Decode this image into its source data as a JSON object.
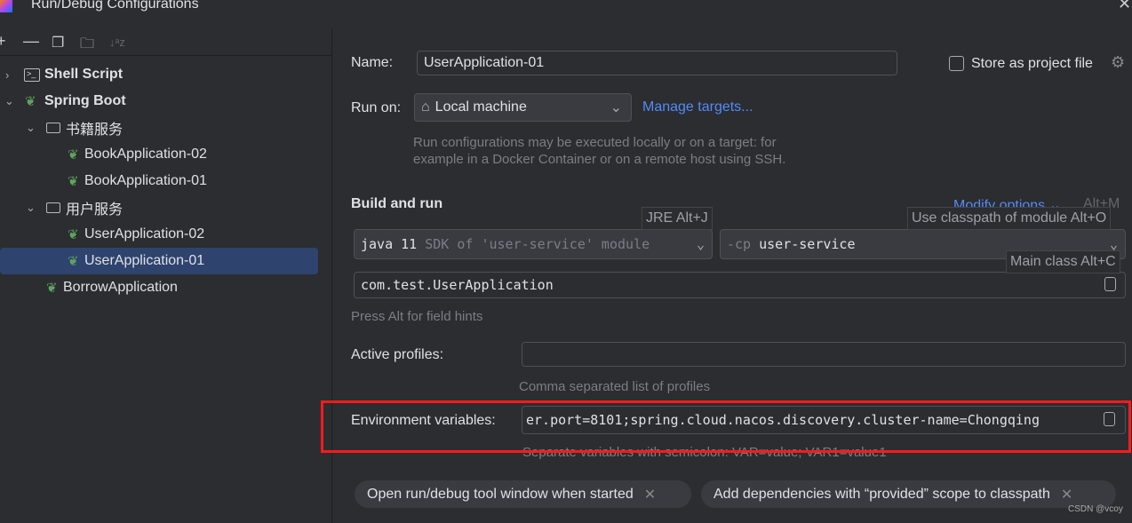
{
  "window": {
    "title": "Run/Debug Configurations"
  },
  "toolbar": {
    "icons": [
      "add-icon",
      "remove-icon",
      "copy-icon",
      "new-folder-icon",
      "sort-icon"
    ]
  },
  "tree": {
    "shell_script": "Shell Script",
    "spring_boot": "Spring Boot",
    "folder1": "书籍服务",
    "book2": "BookApplication-02",
    "book1": "BookApplication-01",
    "folder2": "用户服务",
    "user2": "UserApplication-02",
    "user1": "UserApplication-01",
    "borrow": "BorrowApplication"
  },
  "form": {
    "name_label": "Name:",
    "name_value": "UserApplication-01",
    "store_label": "Store as project file",
    "run_on_label": "Run on:",
    "run_on_value": "Local machine",
    "manage_targets": "Manage targets...",
    "run_on_hint1": "Run configurations may be executed locally or on a target: for",
    "run_on_hint2": "example in a Docker Container or on a remote host using SSH.",
    "build_and_run": "Build and run",
    "modify_options": "Modify options",
    "modify_shortcut": "Alt+M",
    "jre_tip": "JRE Alt+J",
    "classpath_tip": "Use classpath of module Alt+O",
    "mainclass_tip": "Main class Alt+C",
    "sdk_strong": "java 11",
    "sdk_rest": "SDK of 'user-service' module",
    "cp_prefix": "-cp",
    "cp_value": "user-service",
    "main_class": "com.test.UserApplication",
    "field_hint": "Press Alt for field hints",
    "profiles_label": "Active profiles:",
    "profiles_value": "",
    "profiles_hint": "Comma separated list of profiles",
    "env_label": "Environment variables:",
    "env_value": "er.port=8101;spring.cloud.nacos.discovery.cluster-name=Chongqing",
    "env_hint": "Separate variables with semicolon: VAR=value; VAR1=value1",
    "chip1": "Open run/debug tool window when started",
    "chip2": "Add dependencies with “provided” scope to classpath"
  },
  "watermark": "CSDN @vcoy"
}
